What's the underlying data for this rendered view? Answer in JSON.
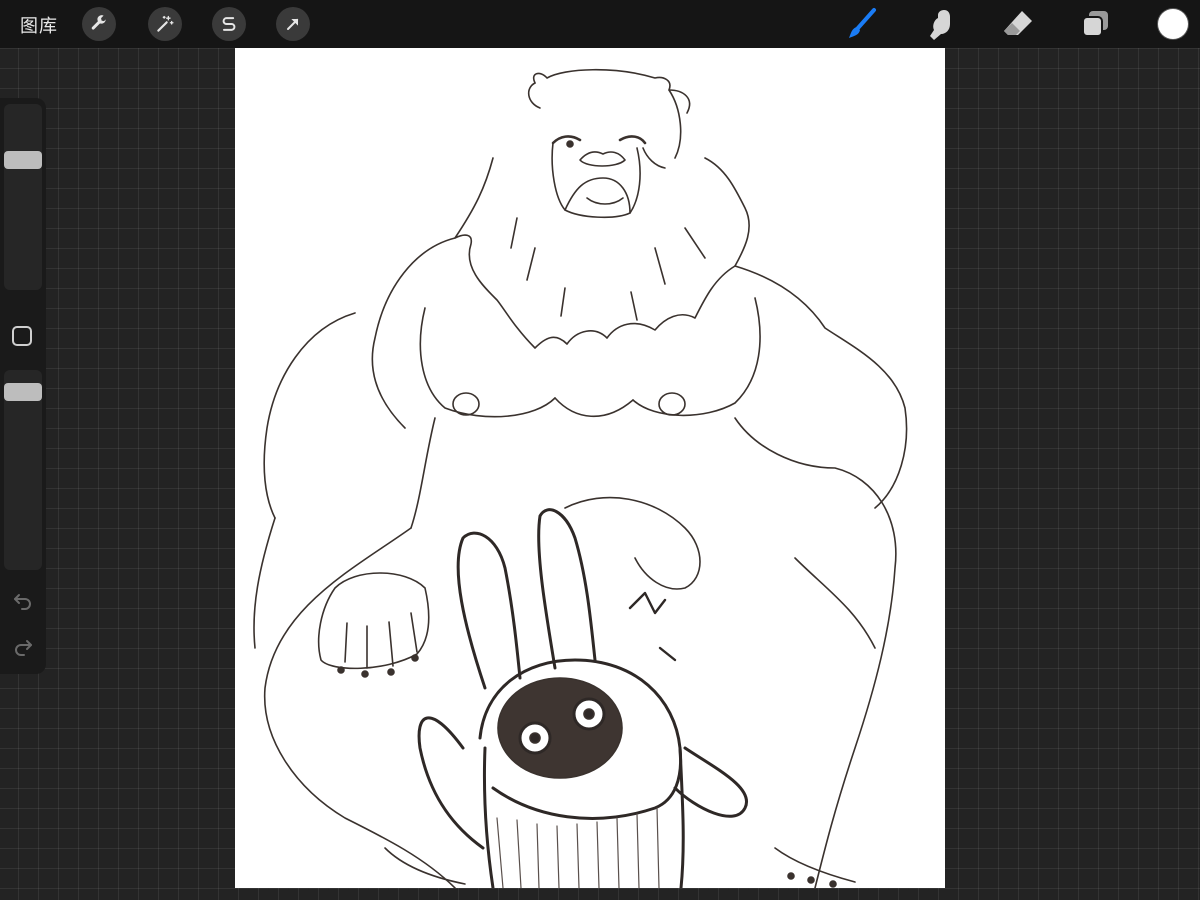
{
  "toolbar": {
    "gallery_label": "图库",
    "left_tools": [
      {
        "name": "actions",
        "icon": "wrench-icon"
      },
      {
        "name": "adjustments",
        "icon": "magic-wand-icon"
      },
      {
        "name": "selection",
        "icon": "selection-s-icon"
      },
      {
        "name": "transform",
        "icon": "arrow-cursor-icon"
      }
    ],
    "right_tools": [
      {
        "name": "brush",
        "icon": "brush-icon",
        "active": true
      },
      {
        "name": "smudge",
        "icon": "smudge-finger-icon",
        "active": false
      },
      {
        "name": "eraser",
        "icon": "eraser-icon",
        "active": false
      },
      {
        "name": "layers",
        "icon": "layers-icon",
        "active": false
      }
    ],
    "active_color": "#ffffff",
    "active_tool_color": "#1a7cf5"
  },
  "sidebar": {
    "brush_size_level": 0.72,
    "opacity_level": 0.93,
    "modify_button_icon": "square-icon",
    "undo_icon": "undo-icon",
    "redo_icon": "redo-icon"
  },
  "canvas": {
    "background": "#ffffff",
    "artwork": "bear-and-bunny-helmet-sketch"
  }
}
